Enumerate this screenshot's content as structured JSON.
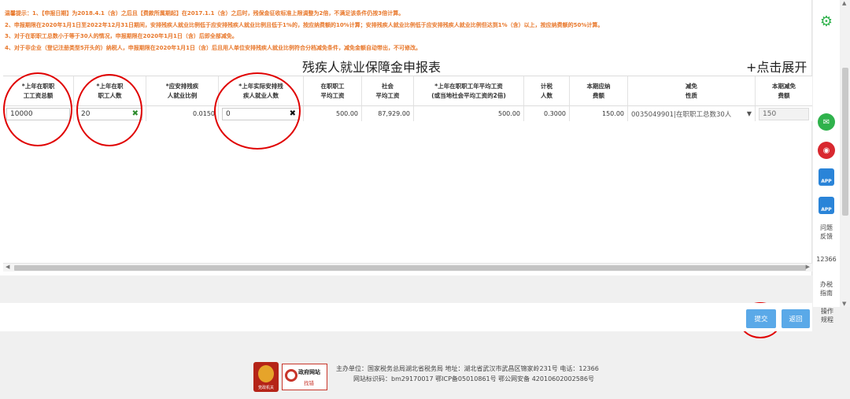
{
  "tips": [
    "温馨提示：1、【申报日期】为2018.4.1（含）之后且【费款所属期起】在2017.1.1（含）之后时，残保金征收标准上限调整为2倍，不满足该条件仍按3倍计算。",
    "2、申报期限在2020年1月1日至2022年12月31日期间，安排残疾人就业比例低于应安排残疾人就业比例且低于1%的，按应纳费额的10%计算；安排残疾人就业比例低于应安排残疾人就业比例但达到1%（含）以上，按应纳费额的50%计算。",
    "3、对于在职职工总数小于等于30人的情况，申报期限在2020年1月1日（含）后即全部减免。",
    "4、对于非企业（登记注册类型5开头的）纳税人，申报期限在2020年1月1日（含）后且用人单位安排残疾人就业比例符合分档减免条件，减免金额自动带出，不可修改。"
  ],
  "form": {
    "title": "残疾人就业保障金申报表",
    "expand_label": "+点击展开"
  },
  "table": {
    "headers": [
      "*上年在职职\n工工资总额",
      "*上年在职\n职工人数",
      "*应安排残疾\n人就业比例",
      "*上年实际安排残\n疾人就业人数",
      "在职职工\n平均工资",
      "社会\n平均工资",
      "*上年在职职工年平均工资\n(或当地社会平均工资的2倍)",
      "计税\n人数",
      "本期应纳\n费额",
      "减免\n性质",
      "本期减免\n费额"
    ],
    "row": {
      "total_wage": "10000",
      "staff_count": "20",
      "ratio": "0.0150",
      "disabled_count": "0",
      "avg_wage": "500.00",
      "social_avg_wage": "87,929.00",
      "annual_avg_wage": "500.00",
      "tax_count": "0.3000",
      "payable": "150.00",
      "relief_type": "0035049901|在职职工总数30人",
      "relief_amount": "150"
    },
    "clear_icon": "✖"
  },
  "side": {
    "feedback_label": "问题\n反馈",
    "phone": "12366",
    "guide_label": "办税\n指南",
    "rules_label": "操作\n规程",
    "app_label": "APP"
  },
  "buttons": {
    "submit": "提交",
    "back": "返回"
  },
  "footer": {
    "line1": "主办单位：国家税务总局湖北省税务局   地址：湖北省武汉市武昌区锦家岭231号  电话：12366",
    "line2": "网站标识码：bm29170017   鄂ICP备05010861号  鄂公网安备 42010602002586号",
    "logo1_caption": "党政机关",
    "logo2_title": "政府网站",
    "logo2_sub": "找错"
  },
  "colors": {
    "tip": "#e8772a",
    "primary": "#5aa9e8",
    "highlight": "#e00000",
    "wechat": "#2fb24c",
    "weibo": "#d8282f"
  }
}
